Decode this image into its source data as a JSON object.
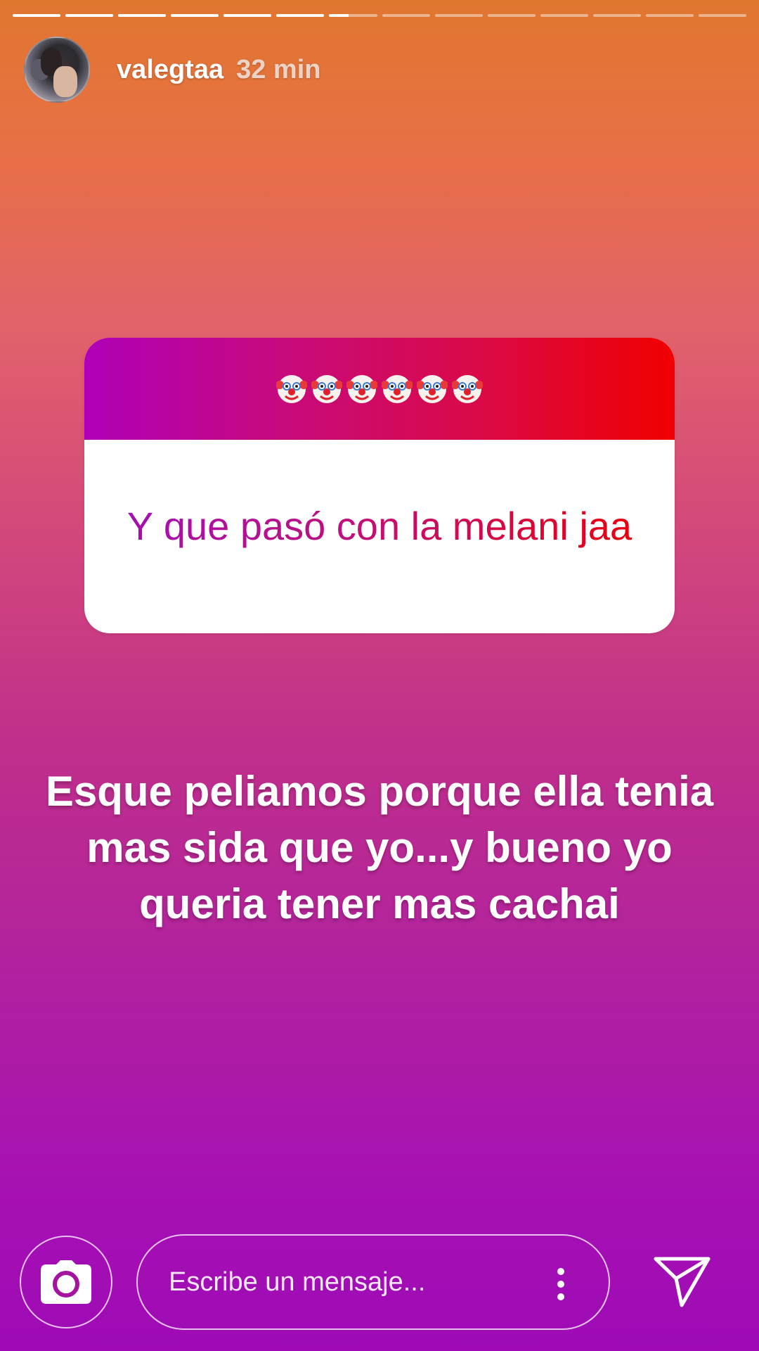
{
  "story": {
    "progress_segments": [
      1,
      1,
      1,
      1,
      1,
      1,
      0.4,
      0,
      0,
      0,
      0,
      0,
      0,
      0
    ]
  },
  "header": {
    "username": "valegtaa",
    "timestamp": "32 min",
    "avatar_icon": "profile-photo"
  },
  "question_sticker": {
    "header_emojis": [
      "clown-face",
      "clown-face",
      "clown-face",
      "clown-face",
      "clown-face",
      "clown-face"
    ],
    "question": "Y que pasó con la melani jaa",
    "gradient_colors": [
      "#b000b8",
      "#f00000"
    ]
  },
  "answer": {
    "text": "Esque peliamos porque ella tenia mas sida que yo...y bueno yo queria tener mas cachai"
  },
  "bottom_bar": {
    "camera_icon": "camera-icon",
    "message_placeholder": "Escribe un mensaje...",
    "more_icon": "more-vertical-icon",
    "send_icon": "send-icon"
  }
}
